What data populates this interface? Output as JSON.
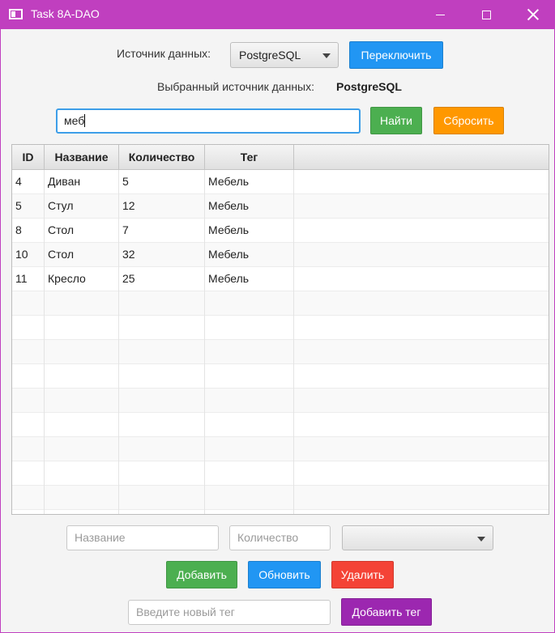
{
  "window": {
    "title": "Task 8A-DAO"
  },
  "source": {
    "label": "Источник данных:",
    "selected": "PostgreSQL",
    "switch_button": "Переключить",
    "current_label": "Выбранный источник данных:",
    "current_value": "PostgreSQL"
  },
  "search": {
    "value": "меб",
    "find_button": "Найти",
    "reset_button": "Сбросить"
  },
  "table": {
    "columns": [
      "ID",
      "Название",
      "Количество",
      "Тег"
    ],
    "rows": [
      [
        "4",
        "Диван",
        "5",
        "Мебель"
      ],
      [
        "5",
        "Стул",
        "12",
        "Мебель"
      ],
      [
        "8",
        "Стол",
        "7",
        "Мебель"
      ],
      [
        "10",
        "Стол",
        "32",
        "Мебель"
      ],
      [
        "11",
        "Кресло",
        "25",
        "Мебель"
      ]
    ]
  },
  "form": {
    "name_placeholder": "Название",
    "quantity_placeholder": "Количество",
    "tag_select_value": "",
    "add_button": "Добавить",
    "update_button": "Обновить",
    "delete_button": "Удалить",
    "new_tag_placeholder": "Введите новый тег",
    "add_tag_button": "Добавить тег"
  },
  "colors": {
    "title_bar": "#c03fbf",
    "blue": "#2196f3",
    "green": "#4caf50",
    "orange": "#ff9800",
    "red": "#f44336",
    "purple": "#9c27b0"
  }
}
